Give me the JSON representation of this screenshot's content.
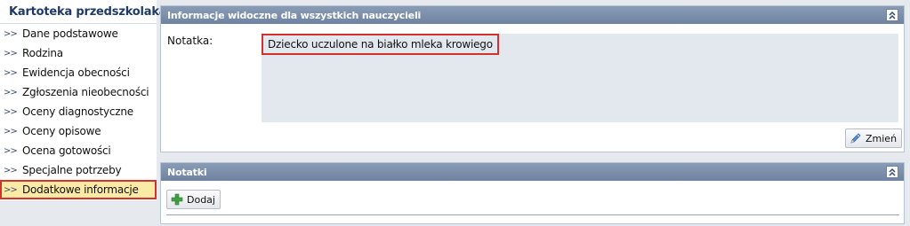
{
  "sidebar": {
    "title": "Kartoteka przedszkolaka",
    "items": [
      {
        "label": "Dane podstawowe"
      },
      {
        "label": "Rodzina"
      },
      {
        "label": "Ewidencja obecności"
      },
      {
        "label": "Zgłoszenia nieobecności"
      },
      {
        "label": "Oceny diagnostyczne"
      },
      {
        "label": "Oceny opisowe"
      },
      {
        "label": "Ocena gotowości"
      },
      {
        "label": "Specjalne potrzeby"
      },
      {
        "label": "Dodatkowe informacje",
        "active": true
      }
    ],
    "chevron": ">>"
  },
  "info_panel": {
    "title": "Informacje widoczne dla wszystkich nauczycieli",
    "note_label": "Notatka:",
    "note_value": "Dziecko uczulone na białko mleka krowiego",
    "change_button": "Zmień"
  },
  "notes_panel": {
    "title": "Notatki",
    "add_button": "Dodaj"
  },
  "colors": {
    "header_bar": "#7b8fac",
    "active_item": "#fbe9a6",
    "highlight_border": "#d0322e"
  },
  "icons": {
    "sidebar_header": "child-profile-icon",
    "collapse": "double-chevron-up-icon",
    "change": "pencil-icon",
    "add": "plus-icon"
  }
}
